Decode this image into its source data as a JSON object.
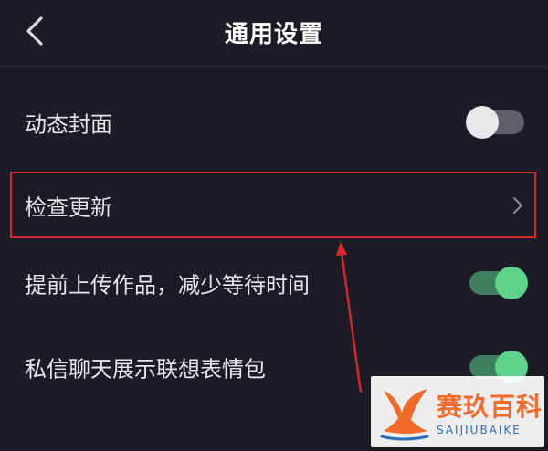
{
  "header": {
    "title": "通用设置",
    "back_icon": "chevron-left-icon"
  },
  "settings": [
    {
      "label": "动态封面",
      "control": "toggle",
      "state": "off"
    },
    {
      "label": "检查更新",
      "control": "chevron",
      "icon": "chevron-right-icon"
    },
    {
      "label": "提前上传作品，减少等待时间",
      "control": "toggle",
      "state": "on"
    },
    {
      "label": "私信聊天展示联想表情包",
      "control": "toggle",
      "state": "on"
    }
  ],
  "watermark": {
    "text_cn": "赛玖百科",
    "text_en": "SAIJIUBAIKE"
  },
  "colors": {
    "background": "#1b1c25",
    "toggle_on": "#5fd28c",
    "toggle_off": "#5f606a",
    "annotation": "#d4272b",
    "watermark_orange": "#f06a2a",
    "watermark_blue": "#2a6fb3"
  }
}
